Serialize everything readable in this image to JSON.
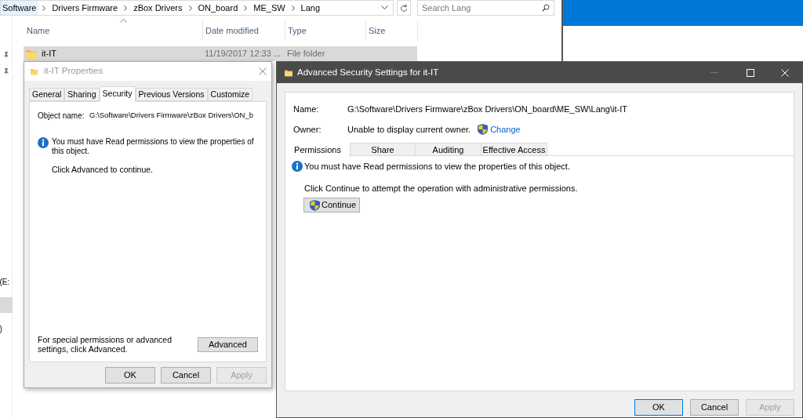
{
  "explorer": {
    "breadcrumb": [
      "Software",
      "Drivers Firmware",
      "zBox Drivers",
      "ON_board",
      "ME_SW",
      "Lang"
    ],
    "search": {
      "placeholder": "Search Lang"
    },
    "columns": [
      "Name",
      "Date modified",
      "Type",
      "Size"
    ],
    "rows": [
      {
        "name": "it-IT",
        "date": "11/19/2017 12:33 ...",
        "type": "File folder",
        "selected": true
      }
    ],
    "nav_items": [
      {
        "label": "(E:",
        "selected": false
      },
      {
        "selected": true
      },
      {
        "label": ")",
        "selected": false
      }
    ]
  },
  "properties": {
    "title": "it-IT Properties",
    "tabs": [
      {
        "label": "General",
        "selected": false
      },
      {
        "label": "Sharing",
        "selected": false
      },
      {
        "label": "Security",
        "selected": true
      },
      {
        "label": "Previous Versions",
        "selected": false
      },
      {
        "label": "Customize",
        "selected": false
      }
    ],
    "object_label": "Object name:",
    "object_value": "G:\\Software\\Drivers Firmware\\zBox Drivers\\ON_b",
    "message": "You must have Read permissions to view the properties of this object.",
    "hint": "Click Advanced to continue.",
    "advanced_text": "For special permissions or advanced settings, click Advanced.",
    "advanced_button": "Advanced",
    "buttons": [
      {
        "label": "OK",
        "disabled": false
      },
      {
        "label": "Cancel",
        "disabled": false
      },
      {
        "label": "Apply",
        "disabled": true
      }
    ]
  },
  "advanced": {
    "title": "Advanced Security Settings for it-IT",
    "name_label": "Name:",
    "name_value": "G:\\Software\\Drivers Firmware\\zBox Drivers\\ON_board\\ME_SW\\Lang\\it-IT",
    "owner_label": "Owner:",
    "owner_value": "Unable to display current owner.",
    "change_link": "Change",
    "tabs": [
      {
        "label": "Permissions",
        "selected": true
      },
      {
        "label": "Share",
        "selected": false
      },
      {
        "label": "Auditing",
        "selected": false
      },
      {
        "label": "Effective Access",
        "selected": false
      }
    ],
    "message": "You must have Read permissions to view the properties of this object.",
    "hint": "Click Continue to attempt the operation with administrative permissions.",
    "continue_button": "Continue",
    "buttons": [
      {
        "label": "OK",
        "disabled": false,
        "default": true
      },
      {
        "label": "Cancel",
        "disabled": false,
        "default": false
      },
      {
        "label": "Apply",
        "disabled": true,
        "default": false
      }
    ]
  }
}
